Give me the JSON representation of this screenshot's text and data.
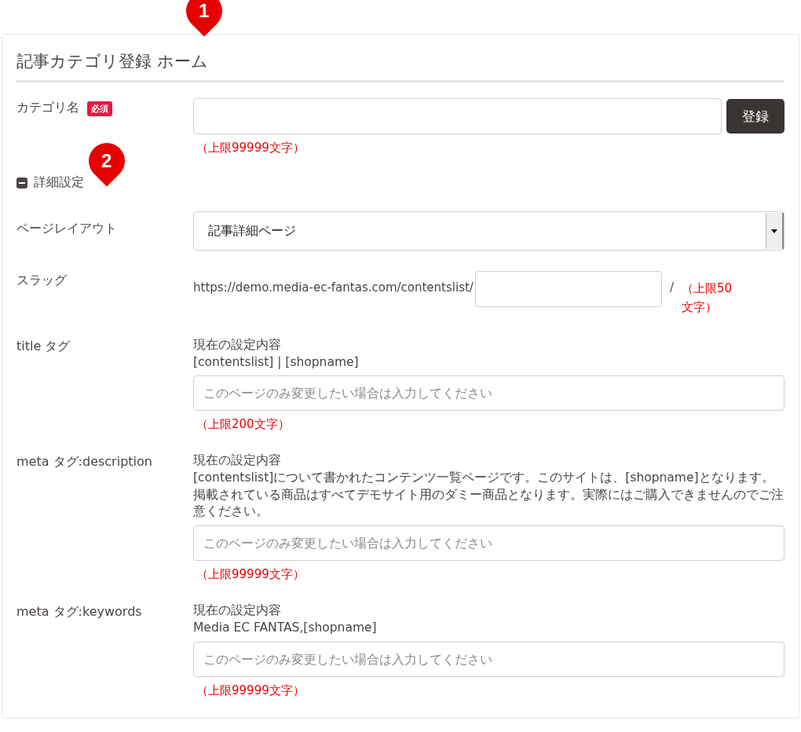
{
  "title": "記事カテゴリ登録 ホーム",
  "markers": [
    {
      "label": "1"
    },
    {
      "label": "2"
    }
  ],
  "category_name": {
    "label": "カテゴリ名",
    "badge": "必須",
    "limit": "（上限99999文字）",
    "button": "登録"
  },
  "details": {
    "label": "詳細設定",
    "expanded": true
  },
  "fields": [
    {
      "kind": "select",
      "label": "ページレイアウト",
      "value": "記事詳細ページ"
    },
    {
      "kind": "slug",
      "label": "スラッグ",
      "prefix": "https://demo.media-ec-fantas.com/contentslist/",
      "suffix": "/",
      "limit": "（上限50文字）"
    },
    {
      "kind": "text",
      "label": "title タグ",
      "current_label": "現在の設定内容",
      "current_value": "[contentslist] | [shopname]",
      "placeholder": "このページのみ変更したい場合は入力してください",
      "limit": "（上限200文字）"
    },
    {
      "kind": "text",
      "label": "meta タグ:description",
      "current_label": "現在の設定内容",
      "current_value": "[contentslist]について書かれたコンテンツ一覧ページです。このサイトは、[shopname]となります。掲載されている商品はすべてデモサイト用のダミー商品となります。実際にはご購入できませんのでご注意ください。",
      "placeholder": "このページのみ変更したい場合は入力してください",
      "limit": "（上限99999文字）"
    },
    {
      "kind": "text",
      "label": "meta タグ:keywords",
      "current_label": "現在の設定内容",
      "current_value": "Media EC FANTAS,[shopname]",
      "placeholder": "このページのみ変更したい場合は入力してください",
      "limit": "（上限99999文字）"
    }
  ]
}
